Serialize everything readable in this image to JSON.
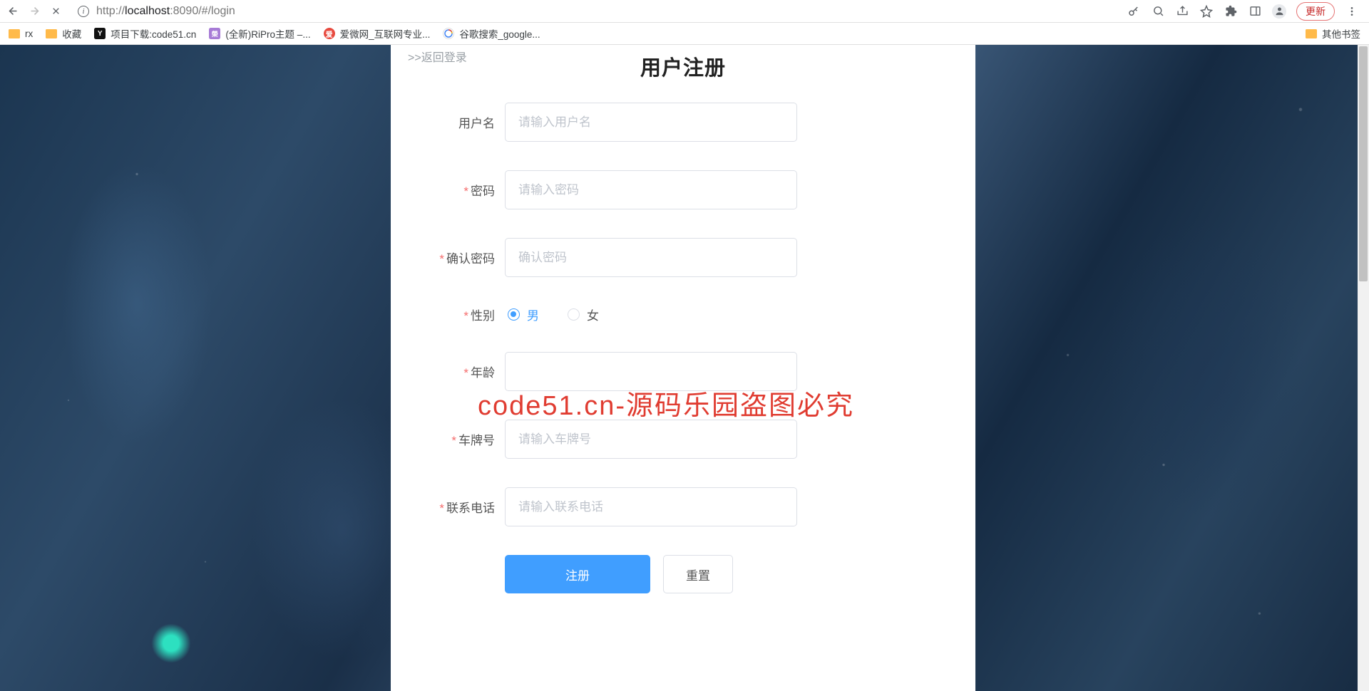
{
  "browser": {
    "url_host": "localhost",
    "url_port_path": ":8090/#/login",
    "url_prefix": "http://",
    "update": "更新"
  },
  "bookmarks": {
    "rx": "rx",
    "collect": "收藏",
    "code51": "项目下载:code51.cn",
    "ripro": "(全新)RiPro主题 –...",
    "aiwei": "爱微网_互联网专业...",
    "google": "谷歌搜索_google...",
    "other": "其他书签"
  },
  "form": {
    "back": ">>返回登录",
    "title": "用户注册",
    "labels": {
      "username": "用户名",
      "password": "密码",
      "confirm": "确认密码",
      "gender": "性别",
      "age": "年龄",
      "plate": "车牌号",
      "phone": "联系电话"
    },
    "placeholders": {
      "username": "请输入用户名",
      "password": "请输入密码",
      "confirm": "确认密码",
      "plate": "请输入车牌号",
      "phone": "请输入联系电话"
    },
    "gender": {
      "male": "男",
      "female": "女"
    },
    "buttons": {
      "register": "注册",
      "reset": "重置"
    }
  },
  "watermark": "code51.cn-源码乐园盗图必究"
}
